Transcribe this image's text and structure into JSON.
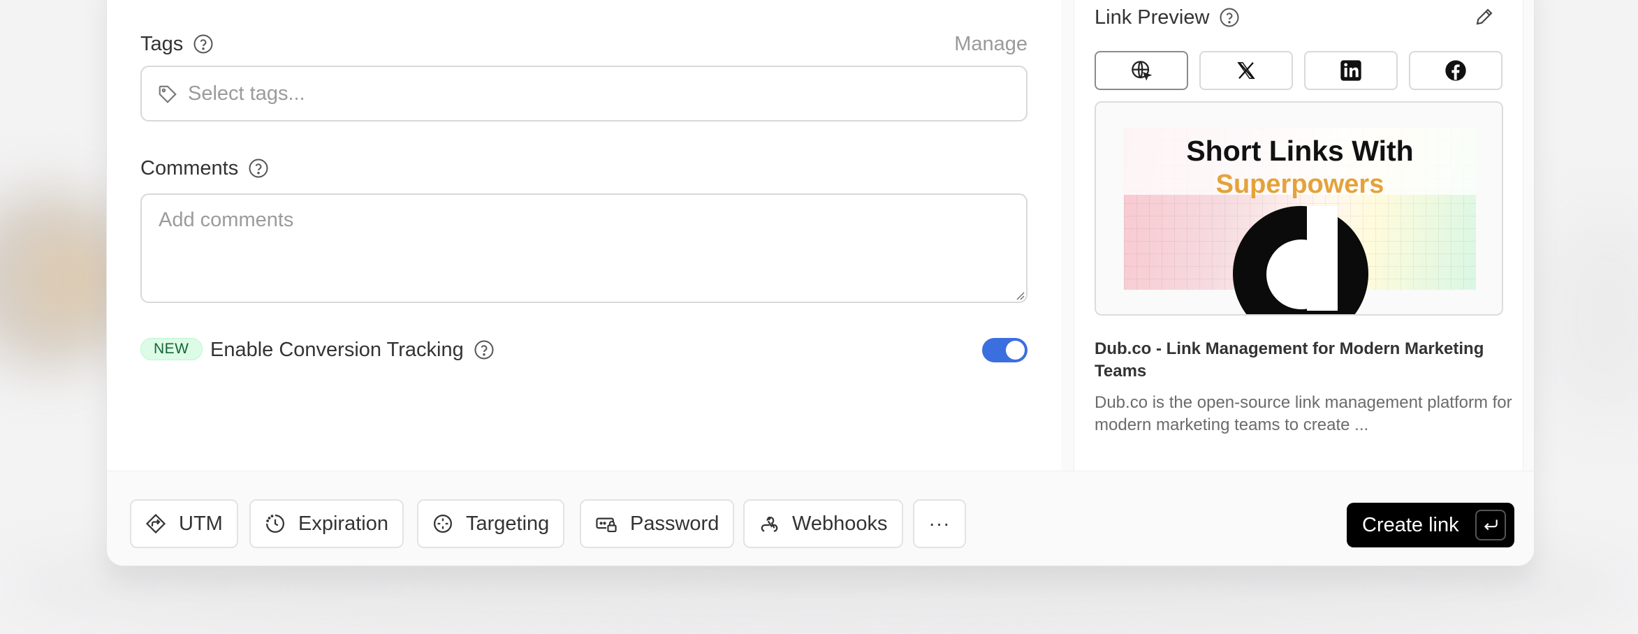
{
  "tags": {
    "label": "Tags",
    "manage_label": "Manage",
    "placeholder": "Select tags..."
  },
  "comments": {
    "label": "Comments",
    "placeholder": "Add comments"
  },
  "conversion": {
    "badge": "NEW",
    "label": "Enable Conversion Tracking",
    "enabled": true
  },
  "link_preview": {
    "label": "Link Preview",
    "tabs": [
      "web-icon",
      "x-icon",
      "linkedin-icon",
      "facebook-icon"
    ],
    "og_title_line1": "Short Links With",
    "og_title_line2": "Superpowers",
    "title": "Dub.co - Link Management for Modern Marketing Teams",
    "description": "Dub.co is the open-source link management platform for modern marketing teams to create ..."
  },
  "footer": {
    "buttons": [
      {
        "label": "UTM",
        "icon": "utm-icon"
      },
      {
        "label": "Expiration",
        "icon": "clock-icon"
      },
      {
        "label": "Targeting",
        "icon": "crosshair-icon"
      },
      {
        "label": "Password",
        "icon": "password-icon"
      },
      {
        "label": "Webhooks",
        "icon": "webhook-icon"
      }
    ],
    "more_label": "···",
    "create_label": "Create link"
  },
  "colors": {
    "toggle_on": "#3b6fe0",
    "badge_bg": "#dcfce7",
    "badge_text": "#166534",
    "og_accent": "#e5a23a"
  }
}
